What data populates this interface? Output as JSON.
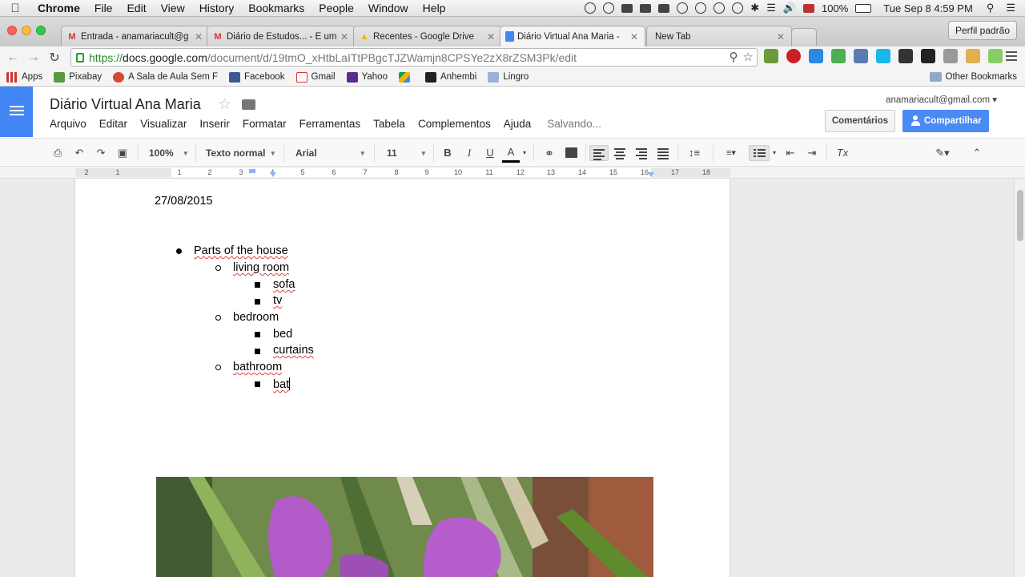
{
  "menubar": {
    "app": "Chrome",
    "items": [
      "File",
      "Edit",
      "View",
      "History",
      "Bookmarks",
      "People",
      "Window",
      "Help"
    ],
    "battery": "100%",
    "clock": "Tue Sep 8  4:59 PM"
  },
  "tabs": [
    {
      "label": "Entrada - anamariacult@g",
      "icon": "gmail-icon"
    },
    {
      "label": "Diário de Estudos... - É um",
      "icon": "gmail-icon"
    },
    {
      "label": "Recentes - Google Drive",
      "icon": "drive-icon"
    },
    {
      "label": "Diário Virtual Ana Maria - ",
      "icon": "docs-icon"
    },
    {
      "label": "New Tab",
      "icon": ""
    }
  ],
  "profile_button": "Perfil padrão",
  "omnibox": {
    "scheme": "https://",
    "host": "docs.google.com",
    "path": "/document/d/19tmO_xHtbLaITtPBgcTJZWamjn8CPSYe2zX8rZSM3Pk/edit"
  },
  "bookmarks": [
    "Apps",
    "Pixabay",
    "A Sala de Aula Sem F",
    "Facebook",
    "Gmail",
    "Yahoo",
    "",
    "Anhembi",
    "Lingro"
  ],
  "bookmarks_other": "Other Bookmarks",
  "docs": {
    "title": "Diário Virtual Ana Maria",
    "menus": [
      "Arquivo",
      "Editar",
      "Visualizar",
      "Inserir",
      "Formatar",
      "Ferramentas",
      "Tabela",
      "Complementos",
      "Ajuda"
    ],
    "status": "Salvando...",
    "account": "anamariacult@gmail.com ▾",
    "comments_button": "Comentários",
    "share_button": "Compartilhar"
  },
  "format_toolbar": {
    "zoom": "100%",
    "style": "Texto normal",
    "font": "Arial",
    "size": "11",
    "bold": "B",
    "italic": "I",
    "underline": "U",
    "text_color": "A",
    "clear_format": "Tx"
  },
  "ruler": [
    "2",
    "1",
    "1",
    "2",
    "3",
    "4",
    "5",
    "6",
    "7",
    "8",
    "9",
    "10",
    "11",
    "12",
    "13",
    "14",
    "15",
    "16",
    "17",
    "18"
  ],
  "document": {
    "date": "27/08/2015",
    "items": [
      {
        "text": "Parts of the house",
        "level": 1
      },
      {
        "text": "living room",
        "level": 2
      },
      {
        "text": "sofa",
        "level": 3
      },
      {
        "text": "tv",
        "level": 3
      },
      {
        "text": "bedroom",
        "level": 2
      },
      {
        "text": "bed",
        "level": 3
      },
      {
        "text": "curtains",
        "level": 3
      },
      {
        "text": "bathroom",
        "level": 2
      },
      {
        "text": "bat",
        "level": 3
      }
    ]
  },
  "colors": {
    "docs_blue": "#4285f4",
    "share_blue": "#4a8af4",
    "omnibox_green": "#2a8a2a"
  }
}
